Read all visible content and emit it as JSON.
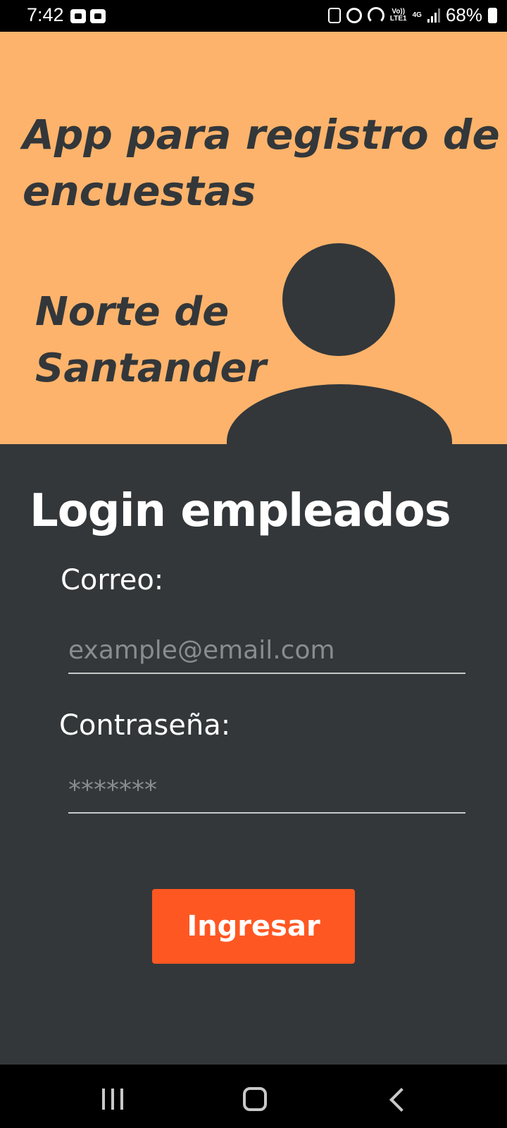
{
  "status_bar": {
    "time": "7:42",
    "volte_line1": "Vo))",
    "volte_line2": "LTE1",
    "network": "4G",
    "battery": "68%"
  },
  "hero": {
    "title": "App para registro de encuestas",
    "subtitle": "Norte de Santander",
    "avatar_icon": "person-icon"
  },
  "login": {
    "title": "Login empleados",
    "email_label": "Correo:",
    "email_placeholder": "example@email.com",
    "email_value": "",
    "password_label": "Contraseña:",
    "password_placeholder": "*******",
    "password_value": "",
    "submit_label": "Ingresar"
  },
  "colors": {
    "hero_bg": "#FDB36B",
    "panel_bg": "#33373A",
    "accent": "#FF5722"
  }
}
